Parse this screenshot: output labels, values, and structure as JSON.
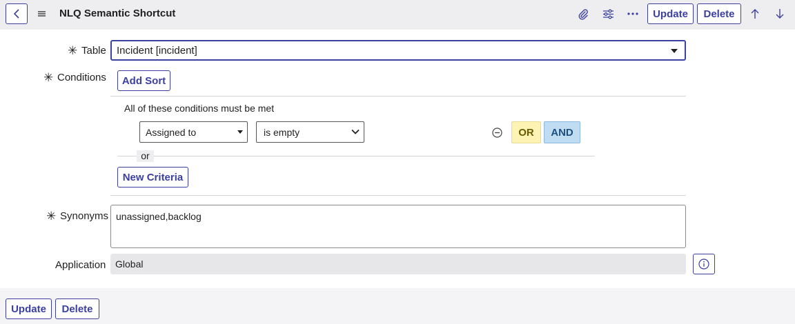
{
  "header": {
    "title": "NLQ Semantic Shortcut",
    "icons": [
      "back-icon",
      "menu-icon",
      "paperclip-icon",
      "sliders-icon",
      "more-icon",
      "arrow-up-icon",
      "arrow-down-icon"
    ],
    "update_label": "Update",
    "delete_label": "Delete"
  },
  "form": {
    "table": {
      "label": "Table",
      "value": "Incident [incident]"
    },
    "conditions": {
      "label": "Conditions",
      "add_sort_label": "Add Sort",
      "all_met_text": "All of these conditions must be met",
      "field_value": "Assigned to",
      "operator_value": "is empty",
      "or_button": "OR",
      "and_button": "AND",
      "or_separator": "or",
      "new_criteria_label": "New Criteria"
    },
    "synonyms": {
      "label": "Synonyms",
      "value": "unassigned,backlog"
    },
    "application": {
      "label": "Application",
      "value": "Global"
    }
  },
  "footer": {
    "update_label": "Update",
    "delete_label": "Delete"
  },
  "colors": {
    "accent": "#3b3fa0",
    "header_bg": "#eeeef1",
    "or_bg": "#fcf3b4",
    "and_bg": "#bfdcf3"
  }
}
